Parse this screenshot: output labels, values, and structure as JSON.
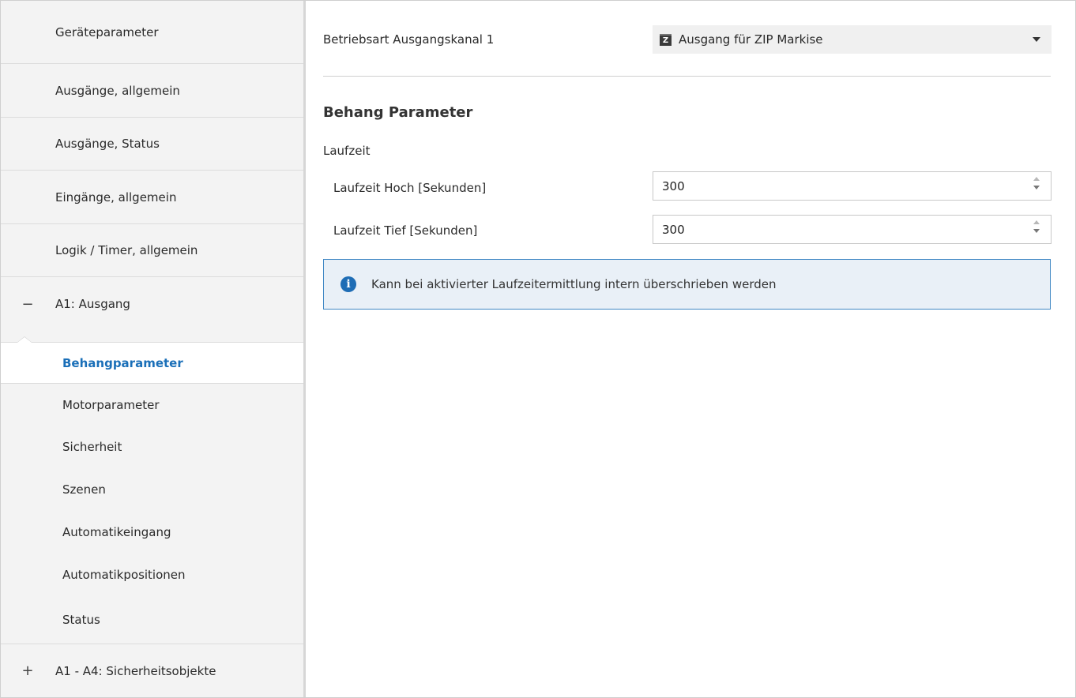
{
  "sidebar": {
    "items": [
      {
        "label": "Geräteparameter"
      },
      {
        "label": "Ausgänge, allgemein"
      },
      {
        "label": "Ausgänge, Status"
      },
      {
        "label": "Eingänge, allgemein"
      },
      {
        "label": "Logik / Timer, allgemein"
      },
      {
        "label": "A1: Ausgang",
        "expander": "−"
      }
    ],
    "subitems": [
      {
        "label": "Behangparameter"
      },
      {
        "label": "Motorparameter"
      },
      {
        "label": "Sicherheit"
      },
      {
        "label": "Szenen"
      },
      {
        "label": "Automatikeingang"
      },
      {
        "label": "Automatikpositionen"
      },
      {
        "label": "Status"
      }
    ],
    "footer_item": {
      "label": "A1 - A4: Sicherheitsobjekte",
      "expander": "+"
    }
  },
  "main": {
    "mode": {
      "label": "Betriebsart Ausgangskanal 1",
      "icon": "Z",
      "value": "Ausgang für ZIP Markise"
    },
    "section_title": "Behang Parameter",
    "group_label": "Laufzeit",
    "fields": [
      {
        "label": "Laufzeit Hoch [Sekunden]",
        "value": "300"
      },
      {
        "label": "Laufzeit Tief [Sekunden]",
        "value": "300"
      }
    ],
    "info": {
      "icon": "i",
      "text": "Kann bei aktivierter Laufzeitermittlung intern überschrieben werden"
    }
  },
  "colors": {
    "accent": "#1a6fb8",
    "info_border": "#3f87c4",
    "info_bg": "#e9f0f7",
    "sidebar_bg": "#f3f3f3"
  }
}
